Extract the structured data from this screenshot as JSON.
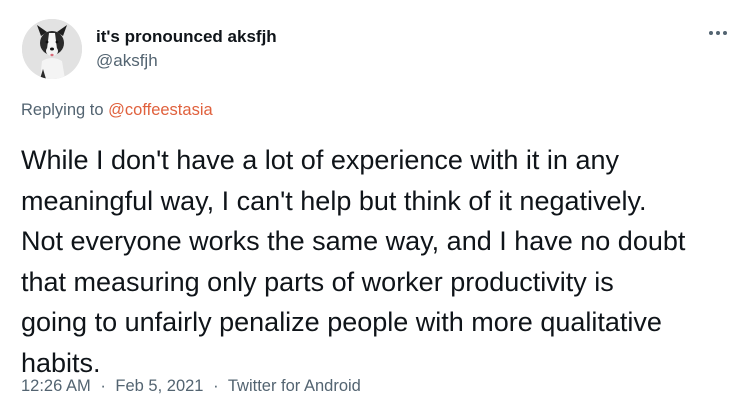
{
  "author": {
    "display_name": "it's pronounced aksfjh",
    "handle": "@aksfjh",
    "avatar_icon": "dog-avatar"
  },
  "more_icon": "more-horizontal-icon",
  "reply": {
    "prefix": "Replying to",
    "mention": "@coffeestasia"
  },
  "tweet": {
    "lines": [
      "While I don't have a lot of experience with it in any",
      "meaningful way, I can't help but think of it negatively.",
      "Not everyone works the same way, and I have no doubt",
      "that measuring only parts of worker productivity is",
      "going to unfairly penalize people with more qualitative",
      "habits."
    ]
  },
  "meta": {
    "time": "12:26 AM",
    "separator": "·",
    "date": "Feb 5, 2021",
    "source": "Twitter for Android"
  },
  "colors": {
    "text": "#0f1419",
    "secondary": "#536471",
    "mention": "#e0613d",
    "background": "#ffffff"
  }
}
